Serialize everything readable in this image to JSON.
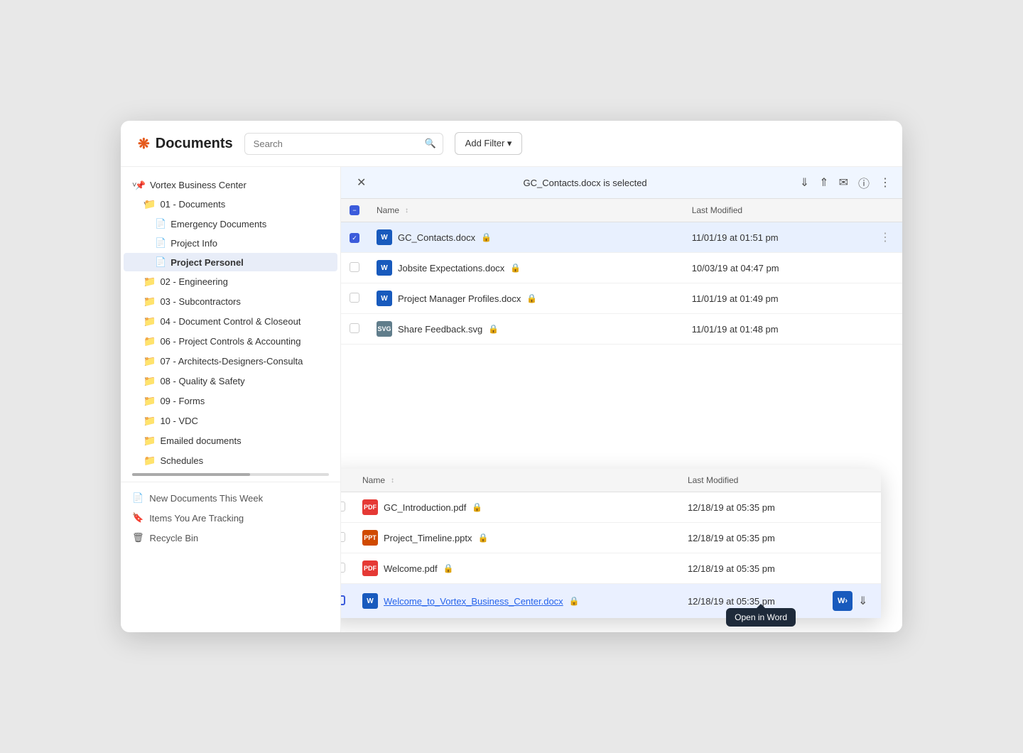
{
  "app": {
    "title": "Documents",
    "gear_icon": "❋"
  },
  "header": {
    "search_placeholder": "Search",
    "add_filter_label": "Add Filter ▾"
  },
  "sidebar": {
    "root_label": "Vortex Business Center",
    "tree": [
      {
        "id": "01-docs",
        "label": "01 - Documents",
        "level": 1,
        "expanded": true,
        "icon": "folder"
      },
      {
        "id": "emergency",
        "label": "Emergency Documents",
        "level": 2,
        "icon": "doc"
      },
      {
        "id": "project-info",
        "label": "Project Info",
        "level": 2,
        "icon": "doc"
      },
      {
        "id": "project-personel",
        "label": "Project Personel",
        "level": 2,
        "icon": "doc",
        "active": true
      },
      {
        "id": "02-eng",
        "label": "02 - Engineering",
        "level": 1,
        "expanded": false,
        "icon": "folder"
      },
      {
        "id": "03-sub",
        "label": "03 - Subcontractors",
        "level": 1,
        "expanded": false,
        "icon": "folder"
      },
      {
        "id": "04-doc",
        "label": "04 - Document Control & Closeout",
        "level": 1,
        "expanded": false,
        "icon": "folder"
      },
      {
        "id": "06-proj",
        "label": "06 - Project Controls & Accounting",
        "level": 1,
        "icon": "folder"
      },
      {
        "id": "07-arch",
        "label": "07 - Architects-Designers-Consulta",
        "level": 1,
        "expanded": false,
        "icon": "folder"
      },
      {
        "id": "08-qual",
        "label": "08 - Quality & Safety",
        "level": 1,
        "expanded": false,
        "icon": "folder"
      },
      {
        "id": "09-forms",
        "label": "09 - Forms",
        "level": 1,
        "expanded": false,
        "icon": "folder"
      },
      {
        "id": "10-vdc",
        "label": "10 - VDC",
        "level": 1,
        "expanded": false,
        "icon": "folder"
      },
      {
        "id": "emailed",
        "label": "Emailed documents",
        "level": 1,
        "expanded": false,
        "icon": "folder"
      },
      {
        "id": "schedules",
        "label": "Schedules",
        "level": 1,
        "icon": "folder"
      }
    ],
    "bottom_items": [
      {
        "id": "new-docs",
        "label": "New Documents This Week",
        "icon": "📄"
      },
      {
        "id": "tracking",
        "label": "Items You Are Tracking",
        "icon": "🔖"
      },
      {
        "id": "recycle",
        "label": "Recycle Bin",
        "icon": "🗑"
      }
    ]
  },
  "file_panel": {
    "selected_label": "GC_Contacts.docx is selected",
    "columns": {
      "name": "Name",
      "last_modified": "Last Modified"
    },
    "files": [
      {
        "id": 1,
        "name": "GC_Contacts.docx",
        "type": "word",
        "modified": "11/01/19 at 01:51 pm",
        "selected": true
      },
      {
        "id": 2,
        "name": "Jobsite Expectations.docx",
        "type": "word",
        "modified": "10/03/19 at 04:47 pm",
        "selected": false
      },
      {
        "id": 3,
        "name": "Project Manager Profiles.docx",
        "type": "word",
        "modified": "11/01/19 at 01:49 pm",
        "selected": false
      },
      {
        "id": 4,
        "name": "Share Feedback.svg",
        "type": "svg",
        "modified": "11/01/19 at 01:48 pm",
        "selected": false
      }
    ]
  },
  "popover_panel": {
    "columns": {
      "name": "Name",
      "last_modified": "Last Modified"
    },
    "files": [
      {
        "id": 1,
        "name": "GC_Introduction.pdf",
        "type": "pdf",
        "modified": "12/18/19 at 05:35 pm",
        "highlighted": false
      },
      {
        "id": 2,
        "name": "Project_Timeline.pptx",
        "type": "ppt",
        "modified": "12/18/19 at 05:35 pm",
        "highlighted": false
      },
      {
        "id": 3,
        "name": "Welcome.pdf",
        "type": "pdf",
        "modified": "12/18/19 at 05:35 pm",
        "highlighted": false
      },
      {
        "id": 4,
        "name": "Welcome_to_Vortex_Business_Center.docx",
        "type": "word",
        "modified": "12/18/19 at 05:35 pm",
        "highlighted": true,
        "link": true
      }
    ],
    "tooltip": "Open in Word"
  }
}
